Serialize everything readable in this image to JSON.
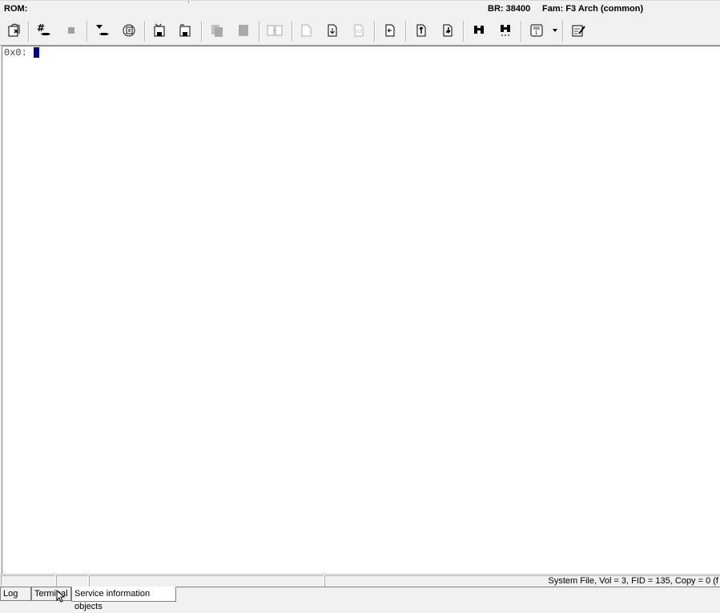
{
  "header": {
    "rom_label": "ROM:",
    "baud_rate": "BR: 38400",
    "family": "Fam: F3 Arch (common)"
  },
  "toolbar": {
    "buttons": [
      {
        "name": "exit-icon",
        "enabled": true
      },
      {
        "name": "connect-icon",
        "enabled": true
      },
      {
        "name": "stop-icon",
        "enabled": false
      },
      {
        "name": "download-icon",
        "enabled": true
      },
      {
        "name": "refresh-icon",
        "enabled": true
      },
      {
        "name": "save-icon",
        "enabled": true
      },
      {
        "name": "save-as-icon",
        "enabled": true
      },
      {
        "name": "copy-icon",
        "enabled": false
      },
      {
        "name": "paste-icon",
        "enabled": false
      },
      {
        "name": "compare-icon",
        "enabled": false
      },
      {
        "name": "new-file-icon",
        "enabled": false
      },
      {
        "name": "file-download-icon",
        "enabled": true
      },
      {
        "name": "file-info-icon",
        "enabled": false
      },
      {
        "name": "file-open-icon",
        "enabled": true
      },
      {
        "name": "upload-icon",
        "enabled": true
      },
      {
        "name": "download-file-icon",
        "enabled": true
      },
      {
        "name": "find-icon",
        "enabled": true
      },
      {
        "name": "find-next-icon",
        "enabled": true
      },
      {
        "name": "info-scroll-icon",
        "enabled": true
      },
      {
        "name": "edit-icon",
        "enabled": true
      }
    ]
  },
  "terminal": {
    "prompt": "0x0:"
  },
  "statusbar": {
    "info": "System File, Vol = 3, FID = 135, Copy = 0 (f"
  },
  "tabs": [
    {
      "label": "Log",
      "active": false
    },
    {
      "label": "Terminal",
      "active": false
    },
    {
      "label": "Service information objects",
      "active": true
    }
  ],
  "colors": {
    "cursor": "#00008b",
    "background": "#f0f0f0",
    "terminal_bg": "#ffffff"
  }
}
